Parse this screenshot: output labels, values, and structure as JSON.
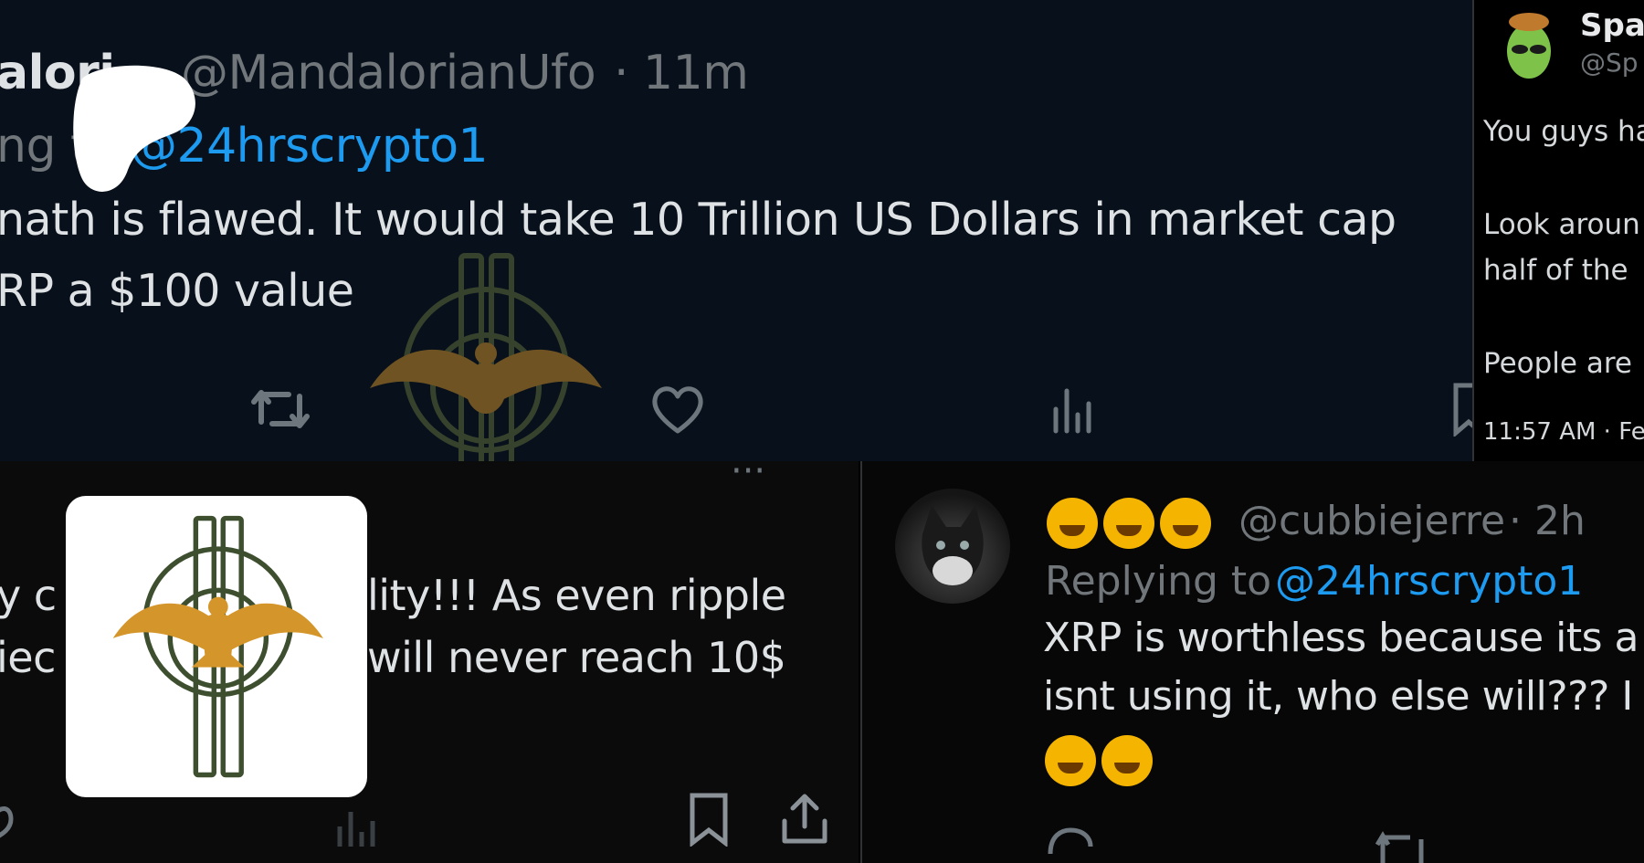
{
  "top_tweet": {
    "author_partial": "alori",
    "handle": "@MandalorianUfo",
    "time": "· 11m",
    "replying_prefix": "ng t",
    "replying_to": "@24hrscrypto1",
    "line1": "nath is flawed. It would take 10 Trillion US Dollars in market cap",
    "line2": "RP a $100 value"
  },
  "right_tweet": {
    "name_partial": "Spac",
    "handle_partial": "@Sp",
    "lines": [
      "You guys ha",
      "Look aroun",
      "half of the",
      "People are",
      "11:57 AM · Fe"
    ]
  },
  "left_tweet": {
    "line1_left": "y c",
    "line1_right": "lity!!! As even ripple",
    "line2_left": "iec",
    "line2_right": "will never reach 10$",
    "menu": "···"
  },
  "br_tweet": {
    "handle": "@cubbiejerre",
    "time": "· 2h",
    "replying_label": "Replying to",
    "replying_to": "@24hrscrypto1",
    "line1": "XRP is worthless because its a",
    "line2": "isnt using it, who else will???  I"
  },
  "colors": {
    "accent": "#1d9bf0",
    "logo_gold": "#d4962b",
    "logo_green": "#3d4f2e"
  },
  "icons": [
    "retweet-icon",
    "like-icon",
    "analytics-icon",
    "bookmark-icon",
    "share-icon",
    "reply-icon",
    "eagle-logo-icon",
    "alien-avatar-icon",
    "cat-avatar"
  ]
}
